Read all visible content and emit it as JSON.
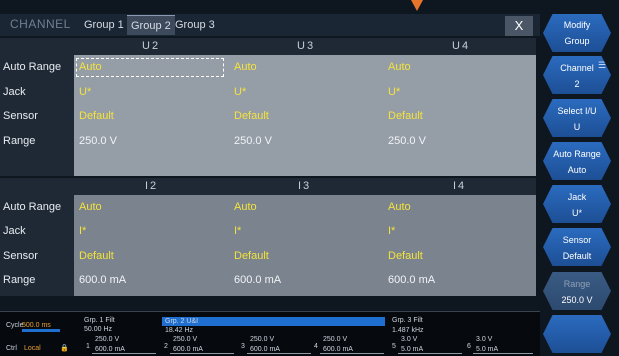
{
  "header": {
    "title": "CHANNEL",
    "tabs": [
      {
        "label": "Group 1",
        "active": false
      },
      {
        "label": "Group 2",
        "active": true
      },
      {
        "label": "Group 3",
        "active": false
      }
    ],
    "close_label": "X"
  },
  "voltage_panel": {
    "columns": [
      "U2",
      "U3",
      "U4"
    ],
    "rows": [
      {
        "label": "Auto Range",
        "values": [
          "Auto",
          "Auto",
          "Auto"
        ]
      },
      {
        "label": "Jack",
        "values": [
          "U*",
          "U*",
          "U*"
        ]
      },
      {
        "label": "Sensor",
        "values": [
          "Default",
          "Default",
          "Default"
        ]
      },
      {
        "label": "Range",
        "values": [
          "250.0 V",
          "250.0 V",
          "250.0 V"
        ]
      }
    ]
  },
  "current_panel": {
    "columns": [
      "I2",
      "I3",
      "I4"
    ],
    "rows": [
      {
        "label": "Auto Range",
        "values": [
          "Auto",
          "Auto",
          "Auto"
        ]
      },
      {
        "label": "Jack",
        "values": [
          "I*",
          "I*",
          "I*"
        ]
      },
      {
        "label": "Sensor",
        "values": [
          "Default",
          "Default",
          "Default"
        ]
      },
      {
        "label": "Range",
        "values": [
          "600.0 mA",
          "600.0 mA",
          "600.0 mA"
        ]
      }
    ]
  },
  "softkeys": [
    {
      "label": "Modify",
      "value": "Group"
    },
    {
      "label": "Channel",
      "value": "2"
    },
    {
      "label": "Select I/U",
      "value": "U"
    },
    {
      "label": "Auto Range",
      "value": "Auto"
    },
    {
      "label": "Jack",
      "value": "U*"
    },
    {
      "label": "Sensor",
      "value": "Default"
    },
    {
      "label": "Range",
      "value": "250.0 V"
    }
  ],
  "status": {
    "cycle_label": "Cycle",
    "cycle_value": "500.0 ms",
    "ctrl_label": "Ctrl",
    "ctrl_value": "Local",
    "groups": [
      {
        "name": "Grp. 1 Filt",
        "freq": "50.00 Hz"
      },
      {
        "name": "Grp. 2 U&I",
        "freq": "18.42 Hz"
      },
      {
        "name": "Grp. 3 Filt",
        "freq": "1.487 kHz"
      }
    ],
    "channels": [
      {
        "num": "1",
        "top": "250.0 V",
        "bottom": "600.0 mA"
      },
      {
        "num": "2",
        "top": "250.0 V",
        "bottom": "600.0 mA"
      },
      {
        "num": "3",
        "top": "250.0 V",
        "bottom": "600.0 mA"
      },
      {
        "num": "4",
        "top": "250.0 V",
        "bottom": "600.0 mA"
      },
      {
        "num": "5",
        "top": "3.0 V",
        "bottom": "5.0 mA"
      },
      {
        "num": "6",
        "top": "3.0 V",
        "bottom": "5.0 mA"
      }
    ]
  },
  "colors": {
    "accent_yellow": "#f4e33c",
    "softkey_blue": "#2b6bbf",
    "indicator_orange": "#e8742c"
  }
}
